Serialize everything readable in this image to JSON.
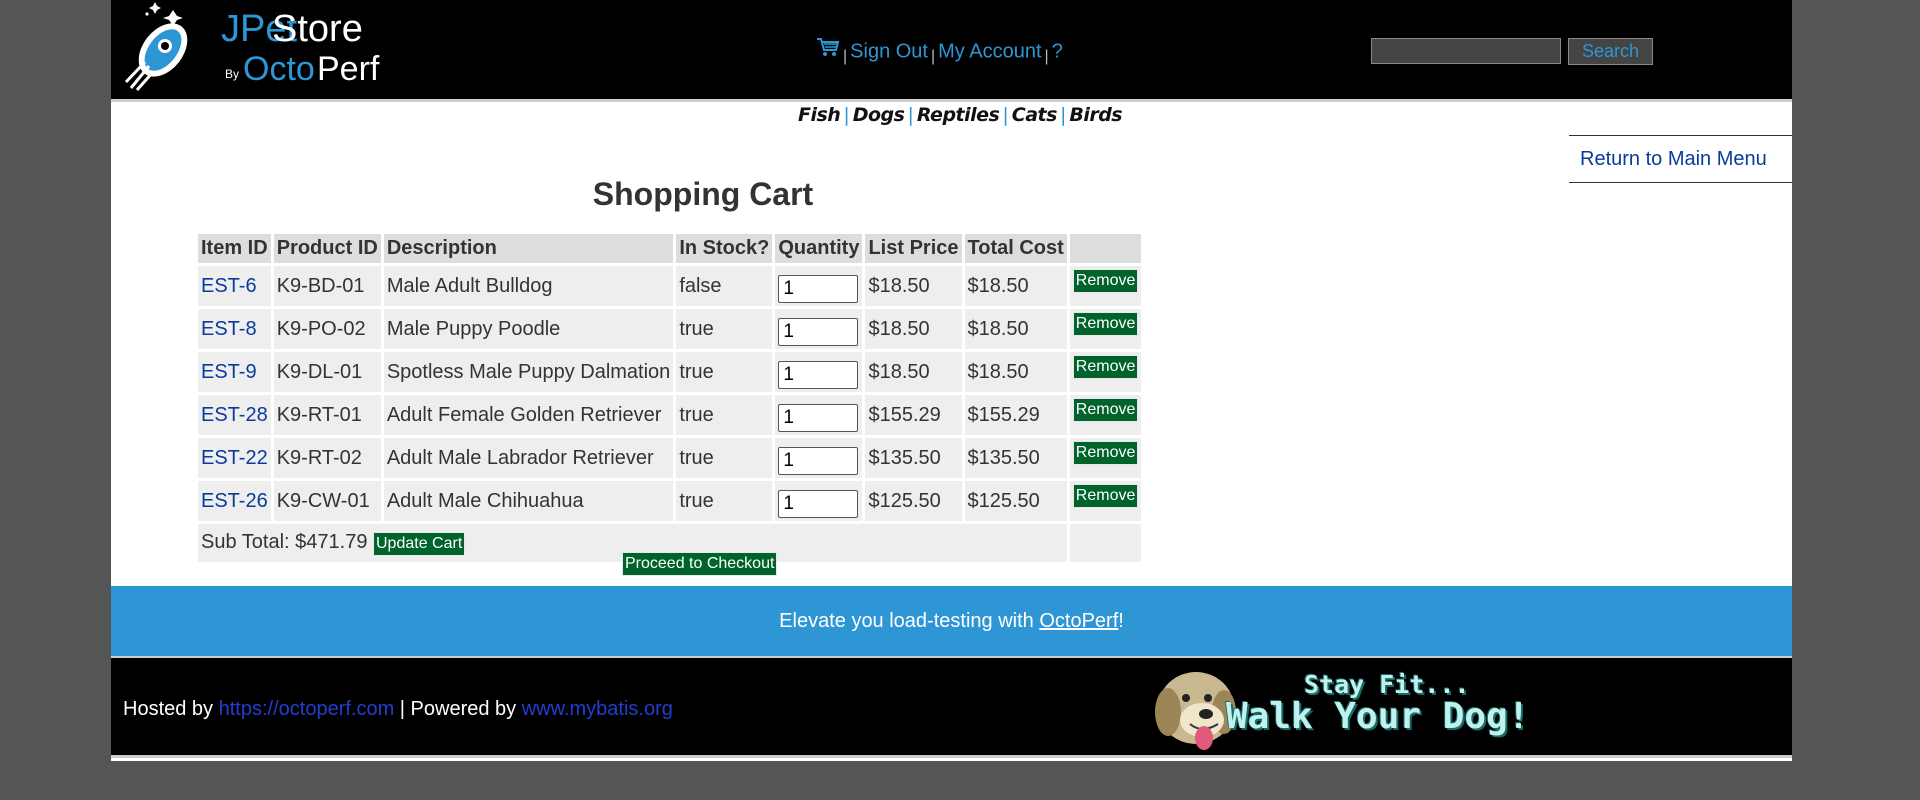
{
  "header": {
    "logo": {
      "j": "JPet",
      "store": "Store",
      "by": "By",
      "octo": "Octo",
      "perf": "Perf"
    },
    "menu": {
      "cart_icon": "cart-icon",
      "sign_out": "Sign Out",
      "my_account": "My Account",
      "help": "?",
      "separator": "|"
    },
    "search": {
      "value": "",
      "button_label": "Search"
    }
  },
  "quicklinks": {
    "fish": "Fish",
    "dogs": "Dogs",
    "reptiles": "Reptiles",
    "cats": "Cats",
    "birds": "Birds",
    "separator": "|"
  },
  "return_link": "Return to Main Menu",
  "cart": {
    "title": "Shopping Cart",
    "columns": [
      "Item ID",
      "Product ID",
      "Description",
      "In Stock?",
      "Quantity",
      "List Price",
      "Total Cost",
      ""
    ],
    "rows": [
      {
        "item_id": "EST-6",
        "product_id": "K9-BD-01",
        "description": "Male Adult Bulldog",
        "in_stock": "false",
        "quantity": "1",
        "list_price": "$18.50",
        "total_cost": "$18.50",
        "remove": "Remove"
      },
      {
        "item_id": "EST-8",
        "product_id": "K9-PO-02",
        "description": "Male Puppy Poodle",
        "in_stock": "true",
        "quantity": "1",
        "list_price": "$18.50",
        "total_cost": "$18.50",
        "remove": "Remove"
      },
      {
        "item_id": "EST-9",
        "product_id": "K9-DL-01",
        "description": "Spotless Male Puppy Dalmation",
        "in_stock": "true",
        "quantity": "1",
        "list_price": "$18.50",
        "total_cost": "$18.50",
        "remove": "Remove"
      },
      {
        "item_id": "EST-28",
        "product_id": "K9-RT-01",
        "description": "Adult Female Golden Retriever",
        "in_stock": "true",
        "quantity": "1",
        "list_price": "$155.29",
        "total_cost": "$155.29",
        "remove": "Remove"
      },
      {
        "item_id": "EST-22",
        "product_id": "K9-RT-02",
        "description": "Adult Male Labrador Retriever",
        "in_stock": "true",
        "quantity": "1",
        "list_price": "$135.50",
        "total_cost": "$135.50",
        "remove": "Remove"
      },
      {
        "item_id": "EST-26",
        "product_id": "K9-CW-01",
        "description": "Adult Male Chihuahua",
        "in_stock": "true",
        "quantity": "1",
        "list_price": "$125.50",
        "total_cost": "$125.50",
        "remove": "Remove"
      }
    ],
    "subtotal": "Sub Total: $471.79",
    "update_label": "Update Cart",
    "checkout_label": "Proceed to Checkout"
  },
  "banner": {
    "prefix": "Elevate you load-testing with ",
    "link": "OctoPerf",
    "suffix": "!"
  },
  "footer": {
    "hosted_by": "Hosted by ",
    "hosted_link": "https://octoperf.com",
    "powered_by": " | Powered by ",
    "powered_link": "www.mybatis.org",
    "dog_line1": "Stay Fit...",
    "dog_line2": "Walk Your Dog!"
  },
  "colors": {
    "brand_blue": "#2e96d4",
    "button_green": "#00632c",
    "link_blue": "#0a3b9c"
  }
}
